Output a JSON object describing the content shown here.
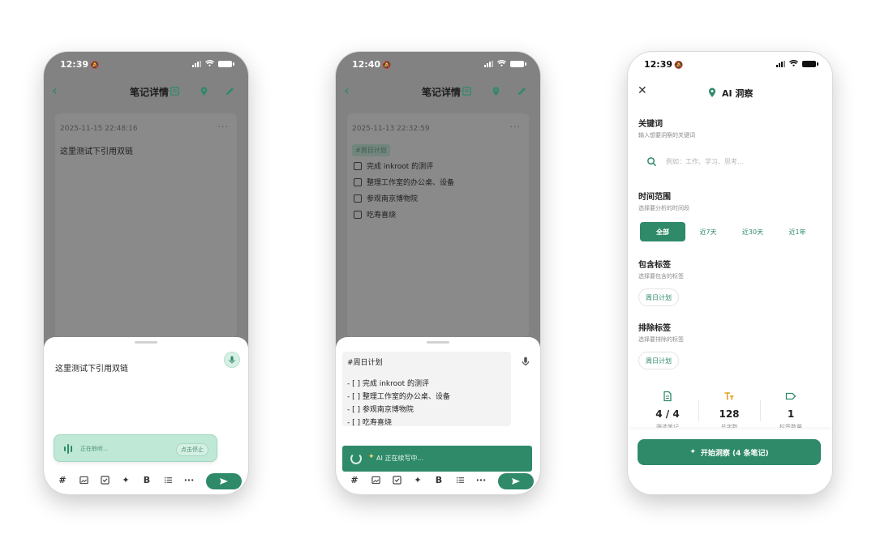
{
  "colors": {
    "accent": "#2e8a68",
    "overlay": "#828282",
    "sheet": "#ffffff"
  },
  "icons": [
    "back-icon",
    "note-icon",
    "location-icon",
    "edit-icon",
    "mic-icon",
    "hash-icon",
    "image-icon",
    "checkbox-icon",
    "sparkle-icon",
    "bold-icon",
    "list-icon",
    "more-icon",
    "send-icon",
    "close-icon",
    "search-icon",
    "document-icon",
    "text-icon",
    "tag-icon"
  ],
  "phones": [
    {
      "status_time": "12:39",
      "title": "笔记详情",
      "note": {
        "date": "2025-11-15 22:48:16",
        "more": "···",
        "text": "这里测试下引用双链"
      },
      "editor": {
        "text": "这里测试下引用双链"
      },
      "listening": {
        "text": "正在聆听...",
        "button": "点击停止"
      },
      "toolbar": {
        "hash": "#",
        "bold": "B",
        "more": "···"
      }
    },
    {
      "status_time": "12:40",
      "title": "笔记详情",
      "note": {
        "date": "2025-11-13 22:32:59",
        "more": "···",
        "tag": "#周日计划",
        "todos": [
          "完成 inkroot 的测评",
          "整理工作室的办公桌、设备",
          "参观南京博物院",
          "吃寿喜烧"
        ]
      },
      "editor": {
        "lines": [
          "#周日计划",
          "- [ ] 完成 inkroot 的测评",
          "- [ ] 整理工作室的办公桌、设备",
          "- [ ] 参观南京博物院",
          "- [ ] 吃寿喜烧"
        ]
      },
      "ai_bar": {
        "text": "AI 正在续写中..."
      },
      "toolbar": {
        "hash": "#",
        "bold": "B",
        "more": "···"
      }
    },
    {
      "status_time": "12:39",
      "header": {
        "title": "AI 洞察"
      },
      "keywords": {
        "title": "关键词",
        "subtitle": "输入想要洞察的关键词",
        "placeholder": "例如：工作、学习、思考..."
      },
      "time_range": {
        "title": "时间范围",
        "subtitle": "选择要分析的时间段",
        "options": [
          "全部",
          "近7天",
          "近30天",
          "近1年"
        ],
        "selected": "全部"
      },
      "include_tags": {
        "title": "包含标签",
        "subtitle": "选择要包含的标签",
        "chip": "周日计划"
      },
      "exclude_tags": {
        "title": "排除标签",
        "subtitle": "选择要排除的标签",
        "chip": "周日计划"
      },
      "stats": [
        {
          "value": "4 / 4",
          "label": "筛选笔记"
        },
        {
          "value": "128",
          "label": "总字数"
        },
        {
          "value": "1",
          "label": "标签数量"
        }
      ],
      "cta": {
        "label": "开始洞察 (4 条笔记)"
      }
    }
  ]
}
